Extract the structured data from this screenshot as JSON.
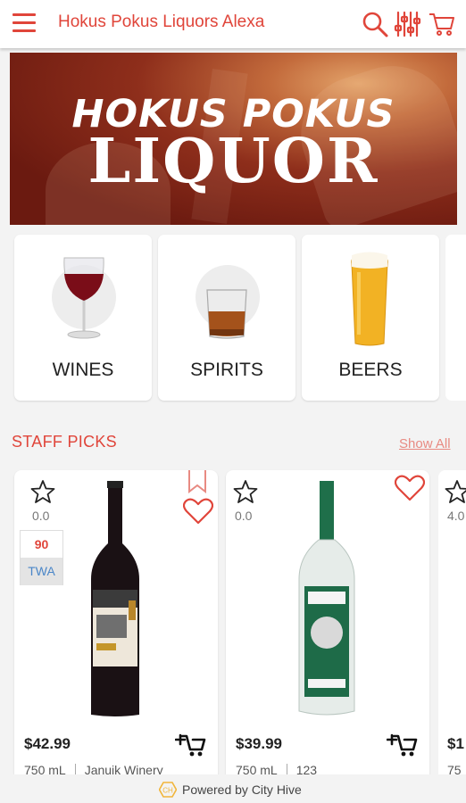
{
  "header": {
    "title": "Hokus Pokus Liquors Alexa",
    "icons": [
      "menu-icon",
      "search-icon",
      "filter-icon",
      "cart-icon"
    ],
    "accent": "#e0453a"
  },
  "banner": {
    "line1": "HOKUS POKUS",
    "line2": "LIQUOR"
  },
  "categories": [
    {
      "label": "WINES",
      "icon": "wine-glass-icon"
    },
    {
      "label": "SPIRITS",
      "icon": "whiskey-glass-icon"
    },
    {
      "label": "BEERS",
      "icon": "beer-glass-icon"
    }
  ],
  "staff_picks": {
    "title": "STAFF PICKS",
    "show_all": "Show All",
    "products": [
      {
        "rating": "0.0",
        "score": "90",
        "score_source": "TWA",
        "price": "$42.99",
        "size": "750 mL",
        "brand": "Januik Winery"
      },
      {
        "rating": "0.0",
        "price": "$39.99",
        "size": "750 mL",
        "brand": "123"
      },
      {
        "rating": "4.0",
        "price": "$1",
        "size": "75"
      }
    ]
  },
  "footer": {
    "text": "Powered by City Hive"
  }
}
